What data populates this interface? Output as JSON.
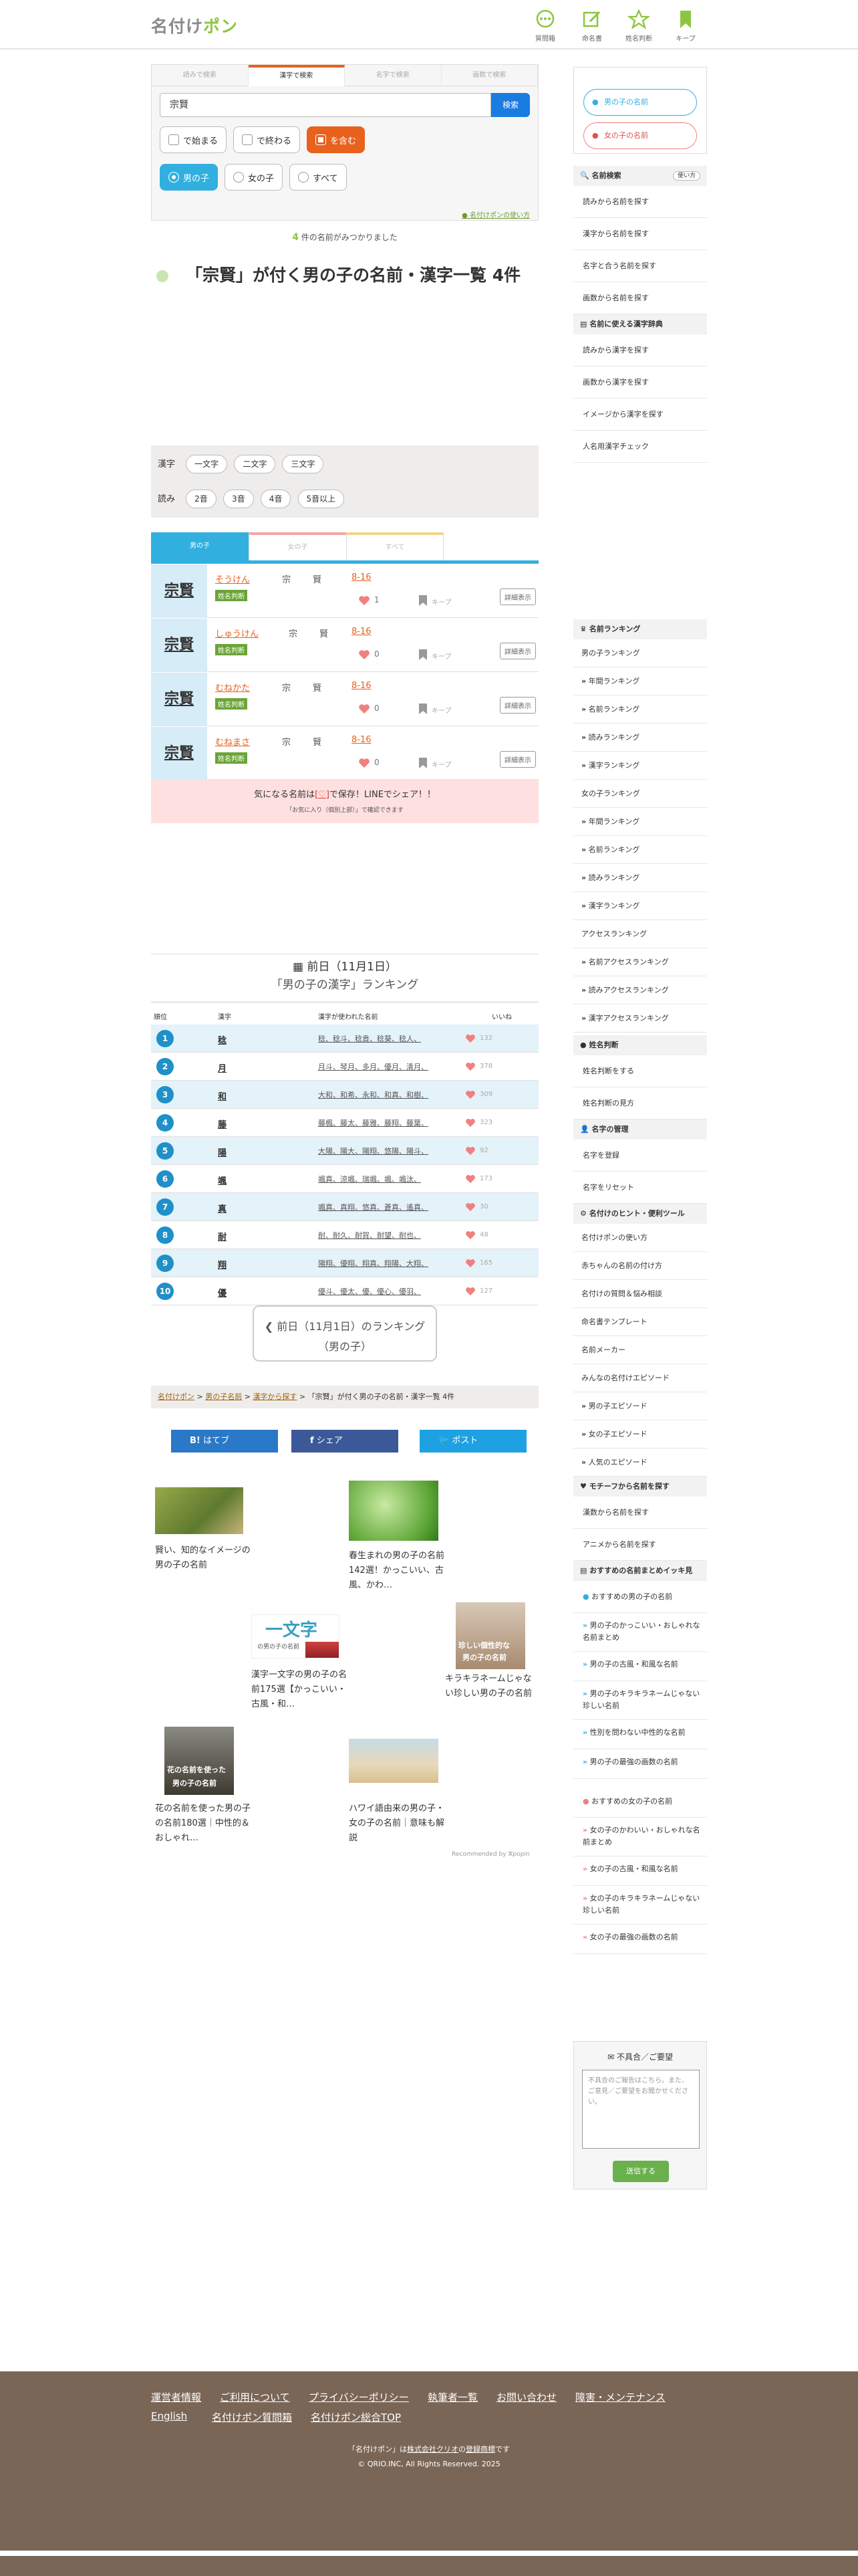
{
  "header": {
    "logo_main": "名付け",
    "logo_accent": "ポン",
    "nav": [
      {
        "label": "質問箱",
        "icon": "chat-icon"
      },
      {
        "label": "命名書",
        "icon": "edit-icon"
      },
      {
        "label": "姓名判断",
        "icon": "star-icon"
      },
      {
        "label": "キープ",
        "icon": "bookmark-icon"
      }
    ]
  },
  "search": {
    "tabs": [
      "読みで検索",
      "漢字で検索",
      "名字で検索",
      "画数で検索"
    ],
    "active_tab": 1,
    "query": "宗賢",
    "button": "検索",
    "match_opts": [
      "で始まる",
      "で終わる",
      "を含む"
    ],
    "gender_opts": [
      "男の子",
      "女の子",
      "すべて"
    ],
    "howto": "名付けポンの使い方"
  },
  "result": {
    "count": "4",
    "count_suffix": "件の名前がみつかりました",
    "title": "「宗賢」が付く男の子の名前・漢字一覧 4件"
  },
  "filters": {
    "kanji_label": "漢字",
    "kanji_opts": [
      "一文字",
      "二文字",
      "三文字"
    ],
    "yomi_label": "読み",
    "yomi_opts": [
      "2音",
      "3音",
      "4音",
      "5音以上"
    ]
  },
  "gender_tabs": [
    "男の子",
    "女の子",
    "すべて"
  ],
  "names": [
    {
      "kanji": "宗賢",
      "yomi": "そうけん",
      "badge": "姓名判断",
      "k1": "宗",
      "k2": "賢",
      "strokes": "8-16",
      "likes": "1",
      "keep": "キープ",
      "detail": "詳細表示"
    },
    {
      "kanji": "宗賢",
      "yomi": "しゅうけん",
      "badge": "姓名判断",
      "k1": "宗",
      "k2": "賢",
      "strokes": "8-16",
      "likes": "0",
      "keep": "キープ",
      "detail": "詳細表示"
    },
    {
      "kanji": "宗賢",
      "yomi": "むねかた",
      "badge": "姓名判断",
      "k1": "宗",
      "k2": "賢",
      "strokes": "8-16",
      "likes": "0",
      "keep": "キープ",
      "detail": "詳細表示"
    },
    {
      "kanji": "宗賢",
      "yomi": "むねまさ",
      "badge": "姓名判断",
      "k1": "宗",
      "k2": "賢",
      "strokes": "8-16",
      "likes": "0",
      "keep": "キープ",
      "detail": "詳細表示"
    }
  ],
  "save_msg": {
    "pre": "気になる名前は",
    "mark": "[♡]",
    "post": "で保存！LINEでシェア！！",
    "sub": "「お気に入り（個別上部）」で確認できます"
  },
  "ranking": {
    "date": "前日（11月1日）",
    "title": "「男の子の漢字」ランキング",
    "cols": [
      "順位",
      "漢字",
      "漢字が使われた名前",
      "いいね"
    ],
    "rows": [
      {
        "rank": "1",
        "kanji": "稔",
        "names": "稔、稔斗、稔貴、稔葵、稔人、",
        "likes": "132"
      },
      {
        "rank": "2",
        "kanji": "月",
        "names": "月斗、琴月、多月、優月、清月、",
        "likes": "378"
      },
      {
        "rank": "3",
        "kanji": "和",
        "names": "大和、和希、永和、和真、和樹、",
        "likes": "309"
      },
      {
        "rank": "4",
        "kanji": "藤",
        "names": "藤楓、藤太、藤雅、藤翔、藤葉、",
        "likes": "323"
      },
      {
        "rank": "5",
        "kanji": "陽",
        "names": "大陽、陽大、陽翔、悠陽、陽斗、",
        "likes": "92"
      },
      {
        "rank": "6",
        "kanji": "颯",
        "names": "颯真、涼颯、瑞颯、颯、颯汰、",
        "likes": "173"
      },
      {
        "rank": "7",
        "kanji": "真",
        "names": "颯真、真翔、悠真、蒼真、遙真、",
        "likes": "30"
      },
      {
        "rank": "8",
        "kanji": "耐",
        "names": "耐、耐久、耐賀、耐望、耐也、",
        "likes": "48"
      },
      {
        "rank": "9",
        "kanji": "翔",
        "names": "陽翔、優翔、翔真、翔陽、大翔、",
        "likes": "165"
      },
      {
        "rank": "10",
        "kanji": "優",
        "names": "優斗、優太、優、優心、優羽、",
        "likes": "127"
      }
    ],
    "prev_btn_1": "前日（11月1日）のランキング",
    "prev_btn_2": "（男の子）"
  },
  "breadcrumb": [
    "名付けポン",
    "男の子名前",
    "漢字から探す",
    "「宗賢」が付く男の子の名前・漢字一覧 4件"
  ],
  "share": {
    "hatena": "はてブ",
    "facebook": "シェア",
    "x": "ポスト"
  },
  "recs": [
    "賢い、知的なイメージの男の子の名前",
    "春生まれの男の子の名前142選！かっこいい、古風、かわ…",
    "漢字一文字の男の子の名前175選【かっこいい・古風・和…",
    "キラキラネームじゃない珍しい男の子の名前",
    "花の名前を使った男の子の名前180選｜中性的＆おしゃれ…",
    "ハワイ語由来の男の子・女の子の名前｜意味も解説"
  ],
  "rec_img_text": {
    "one": "一文字",
    "one_sub": "の男の子の名前",
    "rare": "珍しい個性的な",
    "rare_sub": "男の子の名前",
    "flower": "花の名前を使った",
    "flower_sub": "男の子の名前"
  },
  "rec_by": "Recommended by ⵣpopin",
  "sidebar": {
    "boy_btn": "男の子の名前",
    "girl_btn": "女の子の名前",
    "search_h": "名前検索",
    "search_help": "使い方",
    "search_items": [
      "読みから名前を探す",
      "漢字から名前を探す",
      "名字と合う名前を探す",
      "画数から名前を探す"
    ],
    "dict_h": "名前に使える漢字辞典",
    "dict_items": [
      "読みから漢字を探す",
      "画数から漢字を探す",
      "イメージから漢字を探す",
      "人名用漢字チェック"
    ],
    "rank_h": "名前ランキング",
    "rank_items": [
      "男の子ランキング",
      "年間ランキング",
      "名前ランキング",
      "読みランキング",
      "漢字ランキング",
      "女の子ランキング",
      "年間ランキング",
      "名前ランキング",
      "読みランキング",
      "漢字ランキング",
      "アクセスランキング",
      "名前アクセスランキング",
      "読みアクセスランキング",
      "漢字アクセスランキング"
    ],
    "judge_h": "姓名判断",
    "judge_items": [
      "姓名判断をする",
      "姓名判断の見方"
    ],
    "mgmt_h": "名字の管理",
    "mgmt_items": [
      "名字を登録",
      "名字をリセット"
    ],
    "tools_h": "名付けのヒント・便利ツール",
    "tools_items": [
      "名付けポンの使い方",
      "赤ちゃんの名前の付け方",
      "名付けの質問＆悩み相談",
      "命名書テンプレート",
      "名前メーカー",
      "みんなの名付けエピソード",
      "男の子エピソード",
      "女の子エピソード",
      "人気のエピソード"
    ],
    "motif_h": "モチーフから名前を探す",
    "motif_items": [
      "漢数から名前を探す",
      "アニメから名前を探す"
    ],
    "osusume_h": "おすすめの名前まとめイッキ見",
    "boy_sum_h": "おすすめの男の子の名前",
    "boy_sum": [
      "男の子のかっこいい・おしゃれな名前まとめ",
      "男の子の古風・和風な名前",
      "男の子のキラキラネームじゃない珍しい名前",
      "性別を問わない中性的な名前",
      "男の子の最強の画数の名前"
    ],
    "girl_sum_h": "おすすめの女の子の名前",
    "girl_sum": [
      "女の子のかわいい・おしゃれな名前まとめ",
      "女の子の古風・和風な名前",
      "女の子のキラキラネームじゃない珍しい名前",
      "女の子の最強の画数の名前"
    ],
    "report_h": "不具合／ご要望",
    "report_ph": "不具合のご報告はこちら。また、ご意見／ご要望をお聞かせください。",
    "report_btn": "送信する"
  },
  "footer": {
    "links1": [
      "運営者情報",
      "ご利用について",
      "プライバシーポリシー",
      "執筆者一覧",
      "お問い合わせ",
      "障害・メンテナンス"
    ],
    "links2": [
      "English",
      "名付けポン質問箱",
      "名付けポン総合TOP"
    ],
    "trademark_1": "「名付けポン」は",
    "trademark_link": "株式会社クリオ",
    "trademark_2": "の",
    "trademark_link2": "登録商標",
    "trademark_3": "です",
    "copyright": "© QRIO.INC, All Rights Reserved. 2025"
  },
  "colors": {
    "accent": "#8cc63f",
    "orange": "#e8611d",
    "blue": "#1a7be0",
    "rank_blue": "#1f90c8",
    "footer": "#7a6657"
  }
}
